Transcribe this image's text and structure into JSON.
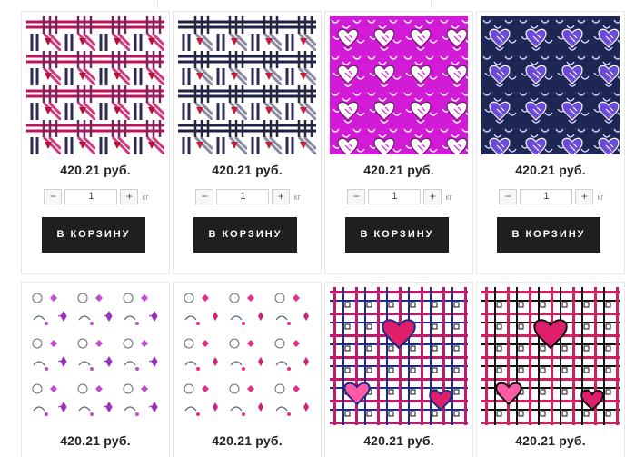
{
  "products": [
    {
      "price": "420.21 руб.",
      "qty": "1",
      "unit": "кг",
      "cart_label": "В КОРЗИНУ",
      "pattern": "geometric-pink"
    },
    {
      "price": "420.21 руб.",
      "qty": "1",
      "unit": "кг",
      "cart_label": "В КОРЗИНУ",
      "pattern": "geometric-navy"
    },
    {
      "price": "420.21 руб.",
      "qty": "1",
      "unit": "кг",
      "cart_label": "В КОРЗИНУ",
      "pattern": "hearts-magenta"
    },
    {
      "price": "420.21 руб.",
      "qty": "1",
      "unit": "кг",
      "cart_label": "В КОРЗИНУ",
      "pattern": "hearts-navy"
    },
    {
      "price": "420.21 руб.",
      "pattern": "floral-white-purple"
    },
    {
      "price": "420.21 руб.",
      "pattern": "floral-white-pink"
    },
    {
      "price": "420.21 руб.",
      "pattern": "plaid-hearts-blue"
    },
    {
      "price": "420.21 руб.",
      "pattern": "plaid-hearts-black"
    }
  ],
  "qty_controls": {
    "minus": "−",
    "plus": "+"
  },
  "colors": {
    "button_bg": "#1f1f1f",
    "magenta": "#d21bd6",
    "navy": "#1e2654",
    "pink": "#e01f6c"
  }
}
